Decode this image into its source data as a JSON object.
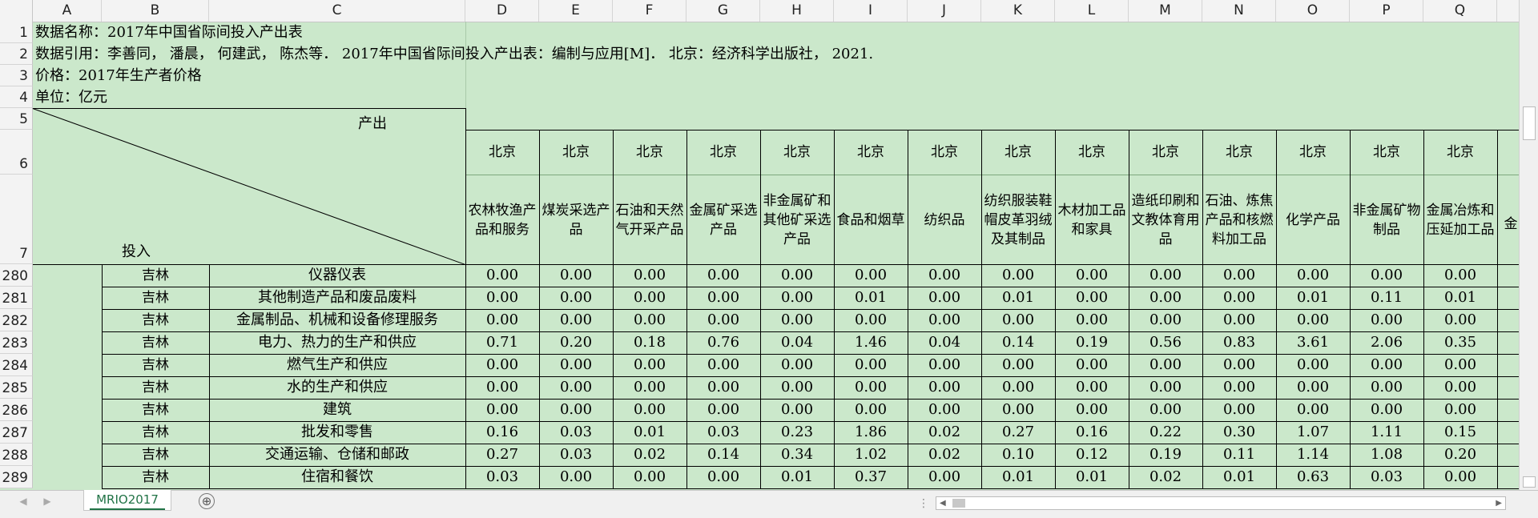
{
  "sheet": {
    "columns": [
      "A",
      "B",
      "C",
      "D",
      "E",
      "F",
      "G",
      "H",
      "I",
      "J",
      "K",
      "L",
      "M",
      "N",
      "O",
      "P",
      "Q"
    ],
    "meta_rows": [
      {
        "row": "1",
        "text": "数据名称：2017年中国省际间投入产出表"
      },
      {
        "row": "2",
        "text": "数据引用：李善同， 潘晨， 何建武， 陈杰等． 2017年中国省际间投入产出表：编制与应用[M]． 北京：经济科学出版社， 2021."
      },
      {
        "row": "3",
        "text": "价格：2017年生产者价格"
      },
      {
        "row": "4",
        "text": "单位：亿元"
      }
    ],
    "header_rows": [
      "5",
      "6",
      "7"
    ],
    "corner": {
      "output_label": "产出",
      "input_label": "投入"
    },
    "region_label": "北京",
    "sectors": [
      "农林牧渔产品和服务",
      "煤炭采选产品",
      "石油和天然气开采产品",
      "金属矿采选产品",
      "非金属矿和其他矿采选产品",
      "食品和烟草",
      "纺织品",
      "纺织服装鞋帽皮革羽绒及其制品",
      "木材加工品和家具",
      "造纸印刷和文教体育用品",
      "石油、炼焦产品和核燃料加工品",
      "化学产品",
      "非金属矿物制品",
      "金属冶炼和压延加工品"
    ],
    "partial_next_sector": "金",
    "data_rows": [
      {
        "row": "280",
        "region": "吉林",
        "sector": "仪器仪表",
        "values": [
          "0.00",
          "0.00",
          "0.00",
          "0.00",
          "0.00",
          "0.00",
          "0.00",
          "0.00",
          "0.00",
          "0.00",
          "0.00",
          "0.00",
          "0.00",
          "0.00"
        ]
      },
      {
        "row": "281",
        "region": "吉林",
        "sector": "其他制造产品和废品废料",
        "values": [
          "0.00",
          "0.00",
          "0.00",
          "0.00",
          "0.00",
          "0.01",
          "0.00",
          "0.01",
          "0.00",
          "0.00",
          "0.00",
          "0.01",
          "0.11",
          "0.01"
        ]
      },
      {
        "row": "282",
        "region": "吉林",
        "sector": "金属制品、机械和设备修理服务",
        "values": [
          "0.00",
          "0.00",
          "0.00",
          "0.00",
          "0.00",
          "0.00",
          "0.00",
          "0.00",
          "0.00",
          "0.00",
          "0.00",
          "0.00",
          "0.00",
          "0.00"
        ]
      },
      {
        "row": "283",
        "region": "吉林",
        "sector": "电力、热力的生产和供应",
        "values": [
          "0.71",
          "0.20",
          "0.18",
          "0.76",
          "0.04",
          "1.46",
          "0.04",
          "0.14",
          "0.19",
          "0.56",
          "0.83",
          "3.61",
          "2.06",
          "0.35"
        ]
      },
      {
        "row": "284",
        "region": "吉林",
        "sector": "燃气生产和供应",
        "values": [
          "0.00",
          "0.00",
          "0.00",
          "0.00",
          "0.00",
          "0.00",
          "0.00",
          "0.00",
          "0.00",
          "0.00",
          "0.00",
          "0.00",
          "0.00",
          "0.00"
        ]
      },
      {
        "row": "285",
        "region": "吉林",
        "sector": "水的生产和供应",
        "values": [
          "0.00",
          "0.00",
          "0.00",
          "0.00",
          "0.00",
          "0.00",
          "0.00",
          "0.00",
          "0.00",
          "0.00",
          "0.00",
          "0.00",
          "0.00",
          "0.00"
        ]
      },
      {
        "row": "286",
        "region": "吉林",
        "sector": "建筑",
        "values": [
          "0.00",
          "0.00",
          "0.00",
          "0.00",
          "0.00",
          "0.00",
          "0.00",
          "0.00",
          "0.00",
          "0.00",
          "0.00",
          "0.00",
          "0.00",
          "0.00"
        ]
      },
      {
        "row": "287",
        "region": "吉林",
        "sector": "批发和零售",
        "values": [
          "0.16",
          "0.03",
          "0.01",
          "0.03",
          "0.23",
          "1.86",
          "0.02",
          "0.27",
          "0.16",
          "0.22",
          "0.30",
          "1.07",
          "1.11",
          "0.15"
        ]
      },
      {
        "row": "288",
        "region": "吉林",
        "sector": "交通运输、仓储和邮政",
        "values": [
          "0.27",
          "0.03",
          "0.02",
          "0.14",
          "0.34",
          "1.02",
          "0.02",
          "0.10",
          "0.12",
          "0.19",
          "0.11",
          "1.14",
          "1.08",
          "0.20"
        ]
      },
      {
        "row": "289",
        "region": "吉林",
        "sector": "住宿和餐饮",
        "values": [
          "0.03",
          "0.00",
          "0.00",
          "0.00",
          "0.01",
          "0.37",
          "0.00",
          "0.01",
          "0.01",
          "0.02",
          "0.01",
          "0.63",
          "0.03",
          "0.00"
        ]
      }
    ]
  },
  "tabs": {
    "sheet_name": "MRIO2017",
    "add_symbol": "⊕"
  },
  "icons": {
    "prev": "◀",
    "next": "▶",
    "left_arrow": "◀",
    "right_arrow": "▶",
    "dots": "⋮"
  },
  "colors": {
    "sheet_bg": "#cbe8cb",
    "tab_accent": "#217346"
  }
}
